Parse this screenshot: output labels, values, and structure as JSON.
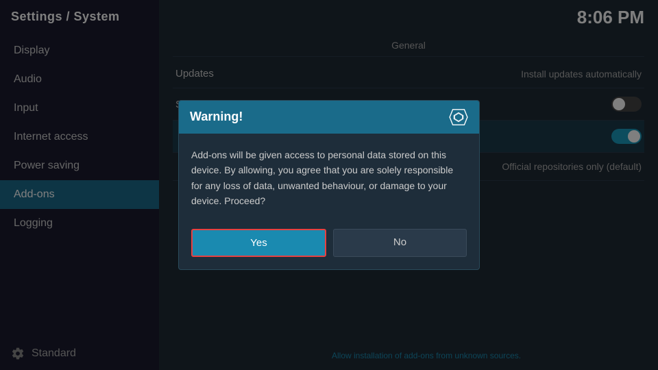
{
  "sidebar": {
    "header": "Settings / System",
    "items": [
      {
        "id": "display",
        "label": "Display",
        "active": false
      },
      {
        "id": "audio",
        "label": "Audio",
        "active": false
      },
      {
        "id": "input",
        "label": "Input",
        "active": false
      },
      {
        "id": "internet-access",
        "label": "Internet access",
        "active": false
      },
      {
        "id": "power-saving",
        "label": "Power saving",
        "active": false
      },
      {
        "id": "add-ons",
        "label": "Add-ons",
        "active": true
      },
      {
        "id": "logging",
        "label": "Logging",
        "active": false
      }
    ],
    "footer_label": "Standard"
  },
  "topbar": {
    "clock": "8:06 PM"
  },
  "main": {
    "section_label": "General",
    "settings": [
      {
        "label": "Updates",
        "value": "Install updates automatically",
        "type": "text"
      },
      {
        "label": "Show notifications",
        "value": "",
        "type": "toggle-off"
      },
      {
        "label": "",
        "value": "",
        "type": "toggle-on"
      }
    ],
    "repo_setting": "Official repositories only (default)",
    "bottom_hint": "Allow installation of add-ons from unknown sources."
  },
  "dialog": {
    "title": "Warning!",
    "body": "Add-ons will be given access to personal data stored on this device. By allowing, you agree that you are solely responsible for any loss of data, unwanted behaviour, or damage to your device. Proceed?",
    "yes_label": "Yes",
    "no_label": "No"
  }
}
